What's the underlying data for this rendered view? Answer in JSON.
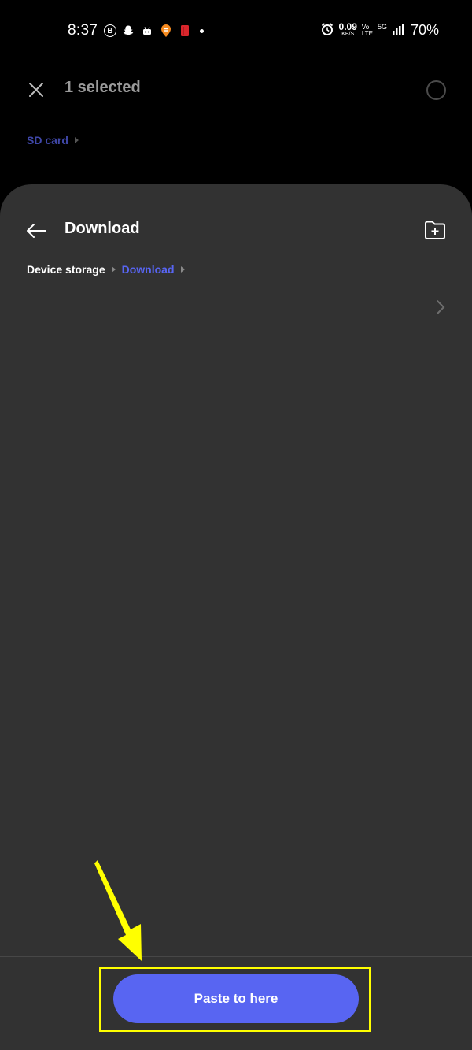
{
  "status_bar": {
    "time": "8:37",
    "left_icons": [
      "b-circle-icon",
      "snapchat-icon",
      "notification-icon",
      "swiggy-icon",
      "red-app-icon",
      "dot-icon"
    ],
    "speed_value": "0.09",
    "speed_unit": "KB/S",
    "volte_top": "Vo",
    "volte_bottom": "LTE",
    "network": "5G",
    "battery": "70%"
  },
  "selection_header": {
    "selected_text": "1 selected",
    "crumb": "SD card"
  },
  "sheet": {
    "title": "Download",
    "breadcrumb": [
      "Device storage",
      "Download"
    ]
  },
  "action": {
    "paste_label": "Paste to here"
  },
  "colors": {
    "accent": "#5865f2",
    "sheet_bg": "#323232",
    "background": "#000000",
    "annotation": "#ffff00"
  }
}
